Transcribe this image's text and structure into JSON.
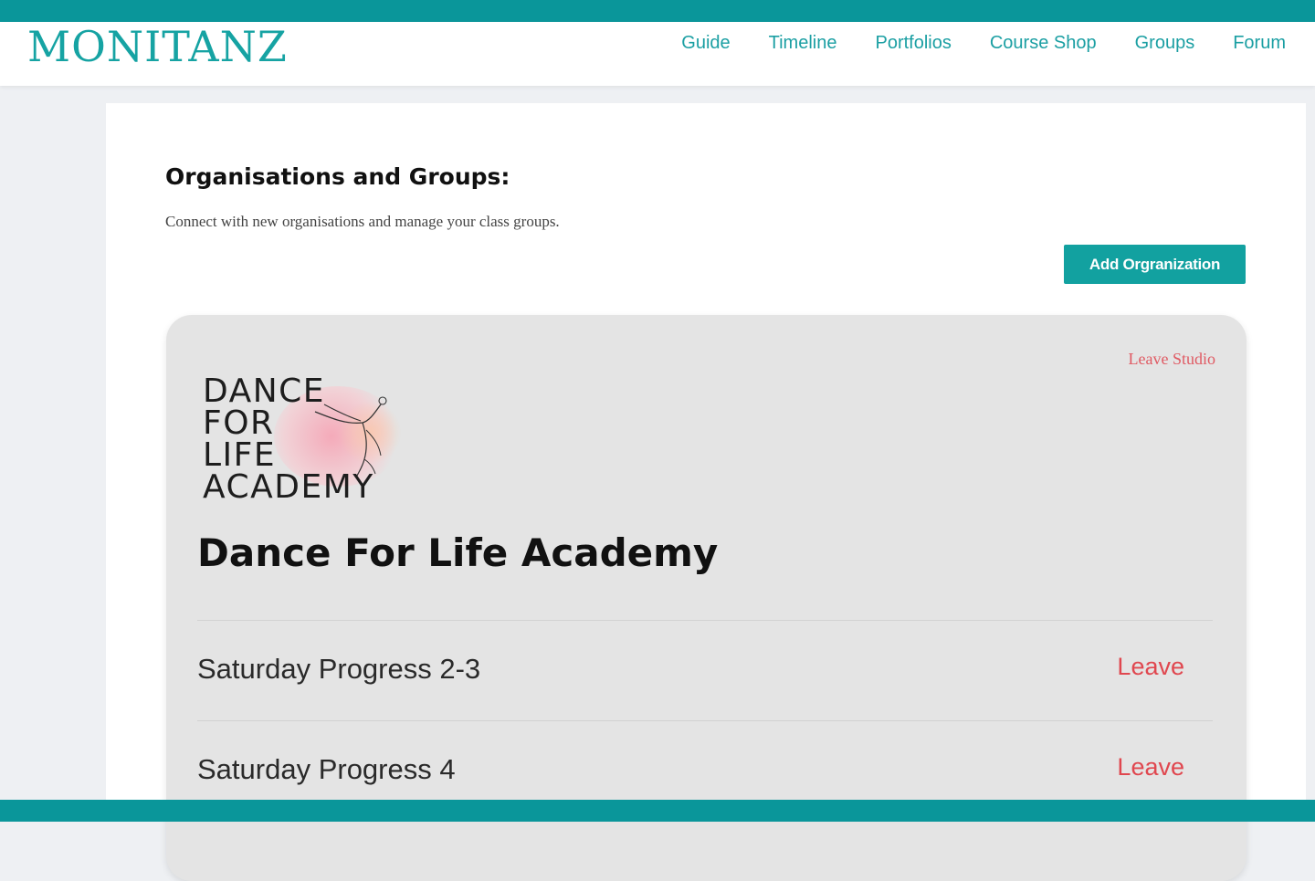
{
  "brand": {
    "logo_text": "MONITANZ"
  },
  "nav": {
    "items": [
      {
        "label": "Guide"
      },
      {
        "label": "Timeline"
      },
      {
        "label": "Portfolios"
      },
      {
        "label": "Course Shop"
      },
      {
        "label": "Groups"
      },
      {
        "label": "Forum"
      }
    ]
  },
  "page": {
    "title": "Organisations and Groups:",
    "subtitle": "Connect with new organisations and manage your class groups.",
    "add_button_label": "Add Orgranization"
  },
  "organization": {
    "logo_lines": [
      "DANCE",
      "FOR",
      "LIFE",
      "ACADEMY"
    ],
    "name": "Dance For Life Academy",
    "leave_studio_label": "Leave Studio",
    "groups": [
      {
        "name": "Saturday Progress 2-3",
        "action_label": "Leave"
      },
      {
        "name": "Saturday Progress 4",
        "action_label": "Leave"
      }
    ]
  },
  "colors": {
    "brand_teal": "#0a969a",
    "button_teal": "#12a1a0",
    "leave_red": "#e0474f",
    "card_gray": "#e4e4e4"
  },
  "icons": [
    "dancer-illustration-icon"
  ]
}
